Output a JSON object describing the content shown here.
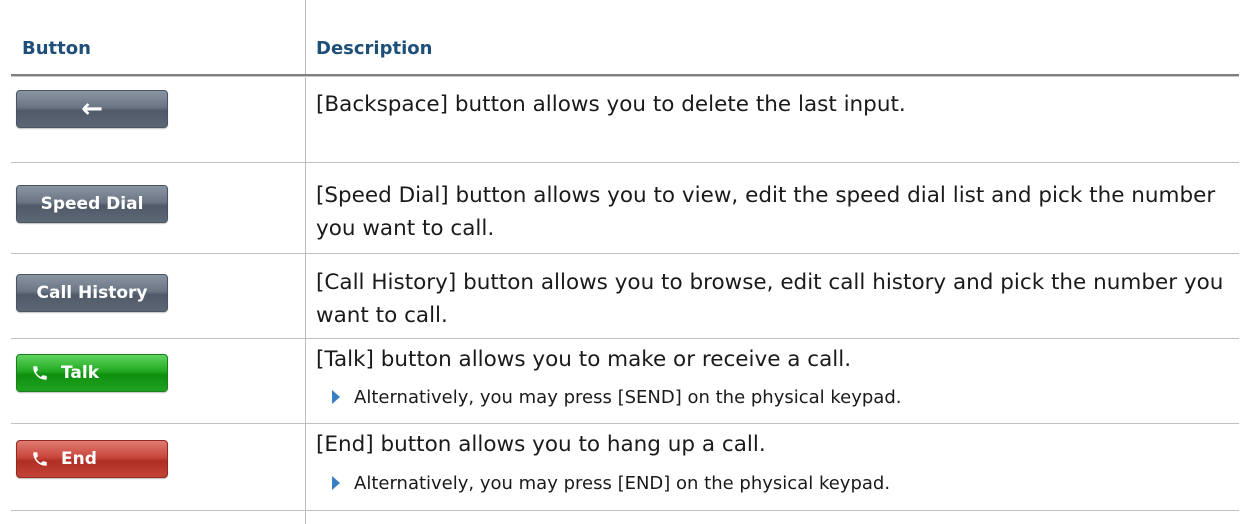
{
  "header": {
    "col1": "Button",
    "col2": "Description"
  },
  "rows": [
    {
      "button_label": "←",
      "button_style": "gray",
      "icon": "left-arrow-icon",
      "description": "[Backspace] button allows you to delete the last input."
    },
    {
      "button_label": "Speed Dial",
      "button_style": "gray",
      "description": "[Speed Dial] button allows you to view, edit the speed dial list and pick the number you want to call."
    },
    {
      "button_label": "Call History",
      "button_style": "gray",
      "description": "[Call History] button allows you to browse, edit call history and pick the number you want to call."
    },
    {
      "button_label": "Talk",
      "button_style": "green",
      "icon": "phone-icon",
      "description": "[Talk] button allows you to make or receive a call.",
      "note": "Alternatively, you may press [SEND] on the physical keypad."
    },
    {
      "button_label": "End",
      "button_style": "red",
      "icon": "phone-icon",
      "description": "[End] button allows you to hang up a call.",
      "note": "Alternatively, you may press [END] on the physical keypad."
    }
  ],
  "colors": {
    "header_text": "#1f4e79",
    "bullet": "#3a7fc1",
    "talk_green": "#1fa21f",
    "end_red": "#c24238",
    "button_gray": "#5d6876"
  }
}
